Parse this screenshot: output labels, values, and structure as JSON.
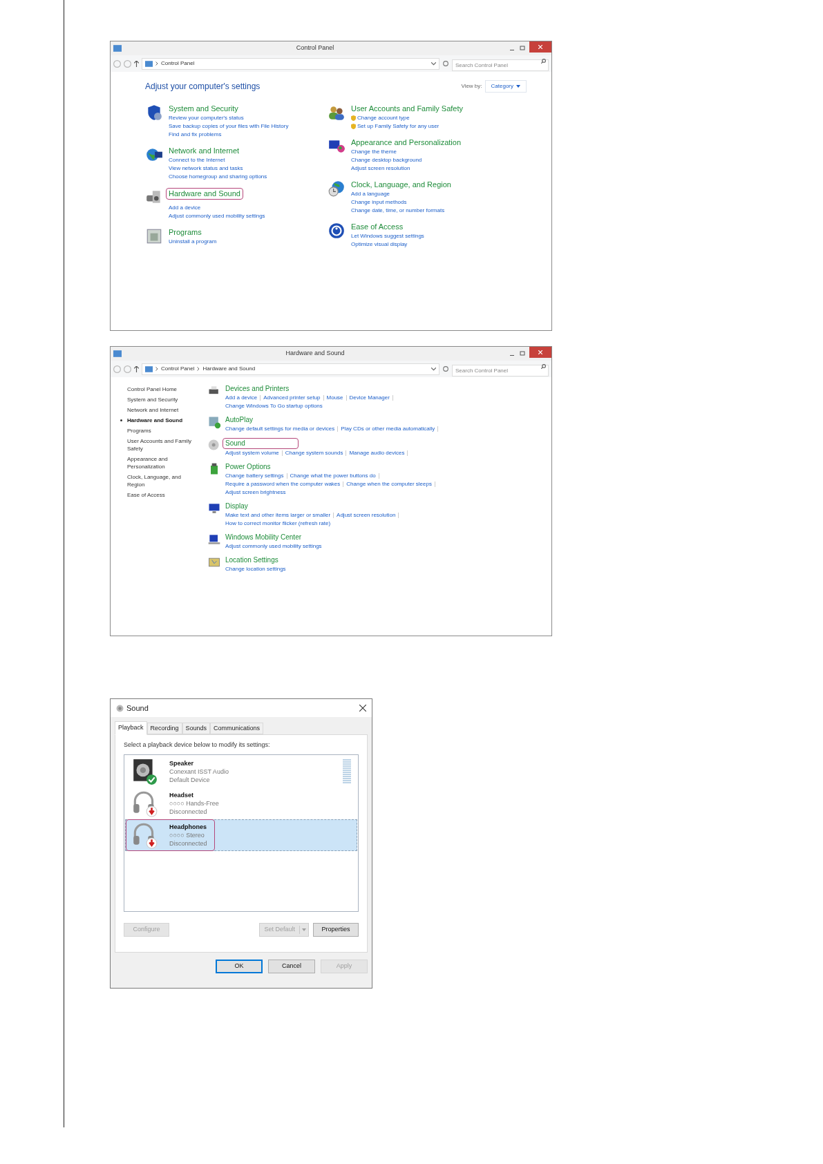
{
  "control_panel": {
    "title": "Control Panel",
    "breadcrumb": [
      "Control Panel"
    ],
    "search": {
      "placeholder": "Search Control Panel"
    },
    "heading": "Adjust your computer's settings",
    "view_by": {
      "label": "View by:",
      "value": "Category"
    },
    "columns": [
      [
        {
          "title": "System and Security",
          "highlighted": false,
          "links": [
            "Review your computer's status",
            "Save backup copies of your files with File History",
            "Find and fix problems"
          ]
        },
        {
          "title": "Network and Internet",
          "highlighted": false,
          "links": [
            "Connect to the Internet",
            "View network status and tasks",
            "Choose homegroup and sharing options"
          ]
        },
        {
          "title": "Hardware and Sound",
          "highlighted": true,
          "links": [
            "Add a device",
            "Adjust commonly used mobility settings"
          ]
        },
        {
          "title": "Programs",
          "highlighted": false,
          "links": [
            "Uninstall a program"
          ]
        }
      ],
      [
        {
          "title": "User Accounts and Family Safety",
          "highlighted": false,
          "links": [
            "Change account type",
            "Set up Family Safety for any user"
          ]
        },
        {
          "title": "Appearance and Personalization",
          "highlighted": false,
          "links": [
            "Change the theme",
            "Change desktop background",
            "Adjust screen resolution"
          ]
        },
        {
          "title": "Clock, Language, and Region",
          "highlighted": false,
          "links": [
            "Add a language",
            "Change input methods",
            "Change date, time, or number formats"
          ]
        },
        {
          "title": "Ease of Access",
          "highlighted": false,
          "links": [
            "Let Windows suggest settings",
            "Optimize visual display"
          ]
        }
      ]
    ]
  },
  "hardware_and_sound": {
    "title": "Hardware and Sound",
    "breadcrumb": [
      "Control Panel",
      "Hardware and Sound"
    ],
    "search": {
      "placeholder": "Search Control Panel"
    },
    "sidebar": {
      "items": [
        {
          "label": "Control Panel Home",
          "selected": false
        },
        {
          "label": "System and Security",
          "selected": false
        },
        {
          "label": "Network and Internet",
          "selected": false
        },
        {
          "label": "Hardware and Sound",
          "selected": true
        },
        {
          "label": "Programs",
          "selected": false
        },
        {
          "label": "User Accounts and Family Safety",
          "selected": false
        },
        {
          "label": "Appearance and Personalization",
          "selected": false
        },
        {
          "label": "Clock, Language, and Region",
          "selected": false
        },
        {
          "label": "Ease of Access",
          "selected": false
        }
      ]
    },
    "sections": [
      {
        "title": "Devices and Printers",
        "highlighted": false,
        "lines": [
          [
            "Add a device",
            "Advanced printer setup",
            "Mouse",
            "Device Manager"
          ],
          [
            "Change Windows To Go startup options"
          ]
        ]
      },
      {
        "title": "AutoPlay",
        "highlighted": false,
        "lines": [
          [
            "Change default settings for media or devices",
            "Play CDs or other media automatically"
          ]
        ]
      },
      {
        "title": "Sound",
        "highlighted": true,
        "lines": [
          [
            "Adjust system volume",
            "Change system sounds",
            "Manage audio devices"
          ]
        ]
      },
      {
        "title": "Power Options",
        "highlighted": false,
        "lines": [
          [
            "Change battery settings",
            "Change what the power buttons do"
          ],
          [
            "Require a password when the computer wakes",
            "Change when the computer sleeps"
          ],
          [
            "Adjust screen brightness"
          ]
        ]
      },
      {
        "title": "Display",
        "highlighted": false,
        "lines": [
          [
            "Make text and other items larger or smaller",
            "Adjust screen resolution"
          ],
          [
            "How to correct monitor flicker (refresh rate)"
          ]
        ]
      },
      {
        "title": "Windows Mobility Center",
        "highlighted": false,
        "lines": [
          [
            "Adjust commonly used mobility settings"
          ]
        ]
      },
      {
        "title": "Location Settings",
        "highlighted": false,
        "lines": [
          [
            "Change location settings"
          ]
        ]
      }
    ]
  },
  "sound_dialog": {
    "title": "Sound",
    "tabs": [
      {
        "label": "Playback",
        "selected": true
      },
      {
        "label": "Recording",
        "selected": false
      },
      {
        "label": "Sounds",
        "selected": false
      },
      {
        "label": "Communications",
        "selected": false
      }
    ],
    "instruction": "Select a playback device below to modify its settings:",
    "devices": [
      {
        "kind": "speaker",
        "name": "Speaker",
        "detail": "Conexant ISST Audio",
        "status": "Default Device",
        "default_device": true,
        "selected": false,
        "highlighted": false
      },
      {
        "kind": "headset",
        "name": "Headset",
        "detail": "○○○○ Hands-Free",
        "status": "Disconnected",
        "default_device": false,
        "selected": false,
        "highlighted": false
      },
      {
        "kind": "headset",
        "name": "Headphones",
        "detail": "○○○○ Stereo",
        "status": "Disconnected",
        "default_device": false,
        "selected": true,
        "highlighted": true
      }
    ],
    "list_buttons": [
      {
        "label": "Configure",
        "disabled": true,
        "kind": "plain"
      },
      {
        "label": "Set Default",
        "disabled": true,
        "kind": "split"
      },
      {
        "label": "Properties",
        "disabled": false,
        "kind": "plain"
      }
    ],
    "footer_buttons": [
      {
        "label": "OK",
        "disabled": false,
        "focused": true
      },
      {
        "label": "Cancel",
        "disabled": false,
        "focused": false
      },
      {
        "label": "Apply",
        "disabled": true,
        "focused": false
      }
    ]
  }
}
